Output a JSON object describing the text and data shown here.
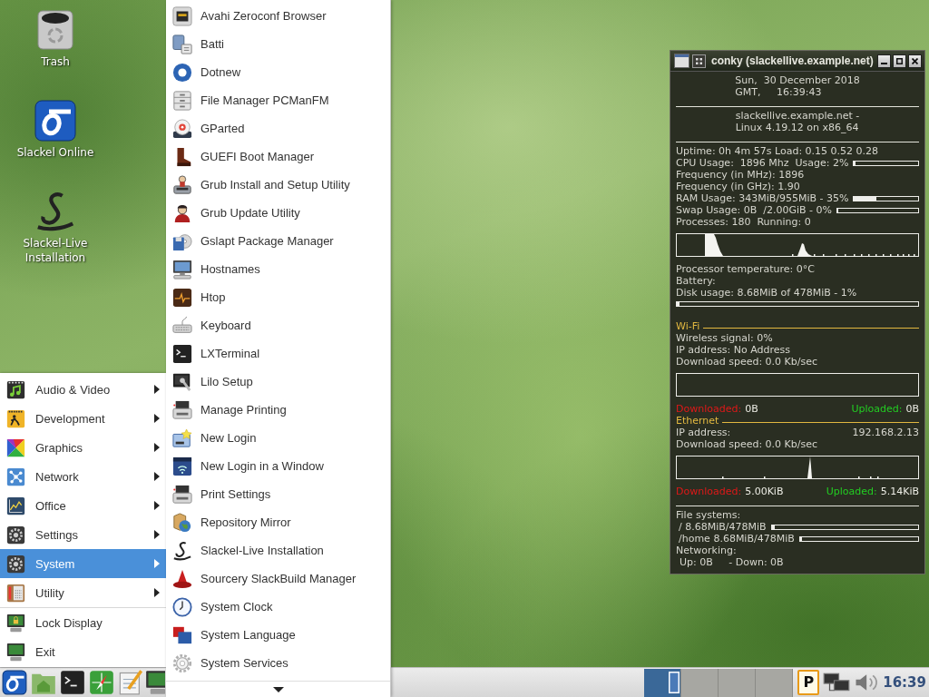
{
  "desktop": {
    "shortcuts": [
      {
        "label": "Trash"
      },
      {
        "label": "Slackel Online"
      },
      {
        "label": "Slackel-Live Installation"
      }
    ]
  },
  "main_menu": {
    "categories": [
      {
        "label": "Audio & Video",
        "selected": false
      },
      {
        "label": "Development",
        "selected": false
      },
      {
        "label": "Graphics",
        "selected": false
      },
      {
        "label": "Network",
        "selected": false
      },
      {
        "label": "Office",
        "selected": false
      },
      {
        "label": "Settings",
        "selected": false
      },
      {
        "label": "System",
        "selected": true
      },
      {
        "label": "Utility",
        "selected": false
      }
    ],
    "actions": [
      {
        "label": "Lock Display",
        "selected": false
      },
      {
        "label": "Exit",
        "selected": false
      }
    ]
  },
  "submenu": {
    "items": [
      {
        "label": "Avahi Zeroconf Browser",
        "selected": false
      },
      {
        "label": "Batti",
        "selected": false
      },
      {
        "label": "Dotnew",
        "selected": false
      },
      {
        "label": "File Manager PCManFM",
        "selected": false
      },
      {
        "label": "GParted",
        "selected": false
      },
      {
        "label": "GUEFI Boot Manager",
        "selected": false
      },
      {
        "label": "Grub Install and Setup Utility",
        "selected": false
      },
      {
        "label": "Grub Update Utility",
        "selected": false
      },
      {
        "label": "Gslapt Package Manager",
        "selected": false
      },
      {
        "label": "Hostnames",
        "selected": false
      },
      {
        "label": "Htop",
        "selected": false
      },
      {
        "label": "Keyboard",
        "selected": false
      },
      {
        "label": "LXTerminal",
        "selected": false
      },
      {
        "label": "Lilo Setup",
        "selected": false
      },
      {
        "label": "Manage Printing",
        "selected": false
      },
      {
        "label": "New Login",
        "selected": false
      },
      {
        "label": "New Login in a Window",
        "selected": false
      },
      {
        "label": "Print Settings",
        "selected": false
      },
      {
        "label": "Repository Mirror",
        "selected": false
      },
      {
        "label": "Slackel-Live Installation",
        "selected": false
      },
      {
        "label": "Sourcery SlackBuild Manager",
        "selected": false
      },
      {
        "label": "System Clock",
        "selected": false
      },
      {
        "label": "System Language",
        "selected": false
      },
      {
        "label": "System Services",
        "selected": false
      }
    ]
  },
  "conky": {
    "title": "conky (slackellive.example.net)",
    "lines": [
      {
        "kind": "block",
        "lines": [
          "Sun,  30 December 2018",
          "GMT,     16:39:43"
        ]
      },
      {
        "kind": "rule"
      },
      {
        "kind": "block",
        "lines": [
          "slackellive.example.net -",
          "Linux 4.19.12 on x86_64"
        ]
      },
      {
        "kind": "rule"
      },
      {
        "kind": "text",
        "text": "Uptime: 0h 4m 57s Load: 0.15 0.52 0.28"
      },
      {
        "kind": "bar_row",
        "text": "CPU Usage:  1896 Mhz  Usage: 2%",
        "level": 0.02
      },
      {
        "kind": "text",
        "text": "Frequency (in MHz): 1896"
      },
      {
        "kind": "text",
        "text": "Frequency (in GHz): 1.90"
      },
      {
        "kind": "bar_row",
        "text": "RAM Usage: 343MiB/955MiB - 35%",
        "level": 0.35
      },
      {
        "kind": "bar_row",
        "text": "Swap Usage: 0B  /2.00GiB - 0%",
        "level": 0
      },
      {
        "kind": "text",
        "text": "Processes: 180  Running: 0"
      },
      {
        "kind": "graph"
      },
      {
        "kind": "text",
        "text": "Processor temperature: 0°C"
      },
      {
        "kind": "text",
        "text": "Battery:"
      },
      {
        "kind": "text",
        "text": "Disk usage: 8.68MiB of 478MiB - 1%"
      },
      {
        "kind": "bar",
        "level": 0.01
      },
      {
        "kind": "section",
        "text": "Wi-Fi"
      },
      {
        "kind": "text",
        "text": "Wireless signal: 0%"
      },
      {
        "kind": "text",
        "text": "IP address: No Address"
      },
      {
        "kind": "text",
        "text": "Download speed: 0.0 Kb/sec"
      },
      {
        "kind": "graph"
      },
      {
        "kind": "traffic",
        "down_label": "Downloaded:",
        "down_value": "0B",
        "up_label": "Uploaded:",
        "up_value": "0B"
      },
      {
        "kind": "section",
        "text": "Ethernet"
      },
      {
        "kind": "pair",
        "label": "IP address:",
        "value": "192.168.2.13"
      },
      {
        "kind": "text",
        "text": "Download speed: 0.0 Kb/sec"
      },
      {
        "kind": "graph"
      },
      {
        "kind": "traffic",
        "down_label": "Downloaded:",
        "down_value": "5.00KiB",
        "up_label": "Uploaded:",
        "up_value": "5.14KiB"
      },
      {
        "kind": "rule"
      },
      {
        "kind": "text",
        "text": "File systems:"
      },
      {
        "kind": "fs_row",
        "text": "/ 8.68MiB/478MiB",
        "level": 0.02
      },
      {
        "kind": "fs_row",
        "text": "/home 8.68MiB/478MiB",
        "level": 0.02
      },
      {
        "kind": "text",
        "text": "Networking:"
      },
      {
        "kind": "indented",
        "text": "Up: 0B     - Down: 0B"
      }
    ]
  },
  "taskbar": {
    "workspaces": [
      {
        "selected": true
      },
      {
        "selected": false
      },
      {
        "selected": false
      },
      {
        "selected": false
      }
    ],
    "tray_indicator": "P",
    "clock": "16:39"
  }
}
